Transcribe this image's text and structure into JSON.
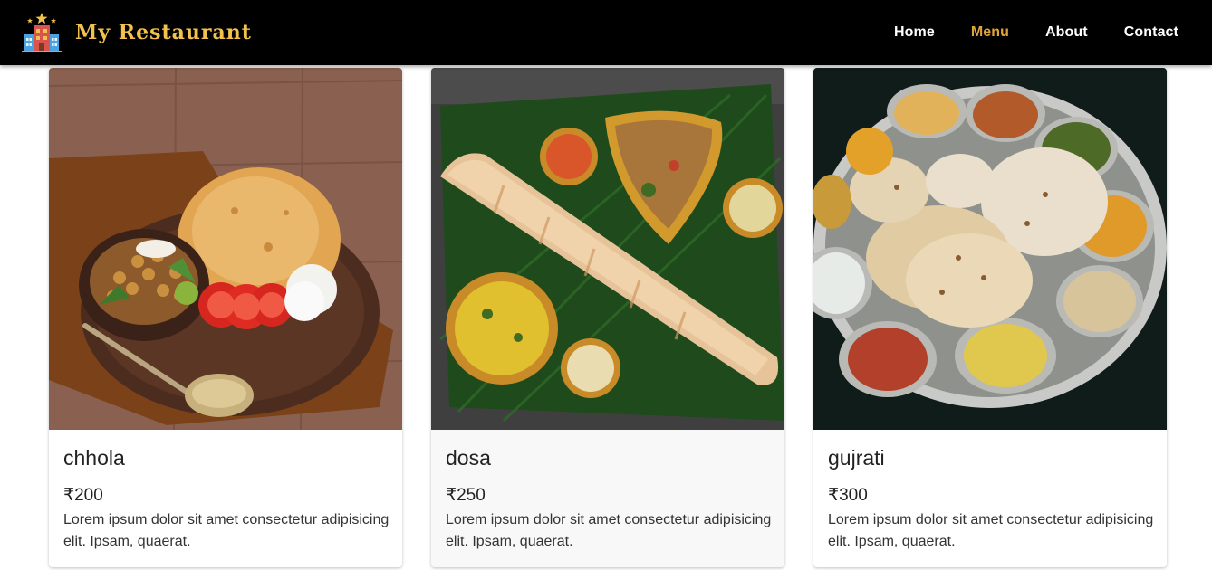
{
  "header": {
    "brand_name": "My Restaurant",
    "nav": [
      {
        "label": "Home",
        "active": false
      },
      {
        "label": "Menu",
        "active": true
      },
      {
        "label": "About",
        "active": false
      },
      {
        "label": "Contact",
        "active": false
      }
    ],
    "brand_color": "#f2c14e",
    "active_color": "#e0a43a",
    "logo_icon": "restaurant-building-icon"
  },
  "menu": {
    "items": [
      {
        "name": "chhola",
        "price": "₹200",
        "description": "Lorem ipsum dolor sit amet consectetur adipisicing elit. Ipsam, quaerat.",
        "image_icon": "chhole-bhature-photo"
      },
      {
        "name": "dosa",
        "price": "₹250",
        "description": "Lorem ipsum dolor sit amet consectetur adipisicing elit. Ipsam, quaerat.",
        "image_icon": "masala-dosa-photo"
      },
      {
        "name": "gujrati",
        "price": "₹300",
        "description": "Lorem ipsum dolor sit amet consectetur adipisicing elit. Ipsam, quaerat.",
        "image_icon": "gujarati-thali-photo"
      }
    ]
  }
}
